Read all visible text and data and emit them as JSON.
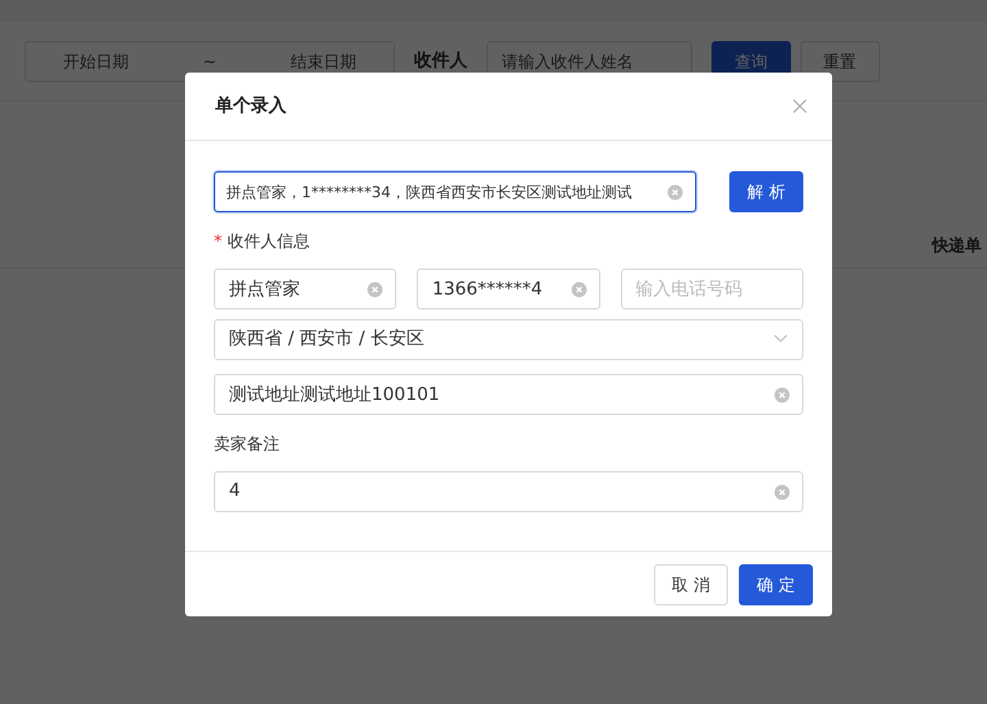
{
  "background_page": {
    "filter": {
      "start_date_placeholder": "开始日期",
      "range_separator": "~",
      "end_date_placeholder": "结束日期",
      "recipient_label": "收件人",
      "recipient_placeholder": "请输入收件人姓名",
      "search_button": "查询",
      "reset_button": "重置"
    },
    "table_header": "快递单"
  },
  "modal": {
    "title": "单个录入",
    "paste_field": {
      "value": "拼点管家，1********34，陕西省西安市长安区测试地址测试",
      "focused": true
    },
    "parse_button": "解 析",
    "recipient_label": "收件人信息",
    "required_mark": "*",
    "recipient_fields": [
      {
        "value": "拼点管家"
      },
      {
        "value": "1366******4"
      },
      {
        "placeholder": "输入电话号码"
      }
    ],
    "region": "陕西省 / 西安市 / 长安区",
    "address": "测试地址测试地址100101",
    "note_label": "卖家备注",
    "note": "4",
    "buttons": [
      {
        "label": "取 消",
        "kind": "default"
      },
      {
        "label": "确 定",
        "kind": "primary"
      }
    ]
  }
}
